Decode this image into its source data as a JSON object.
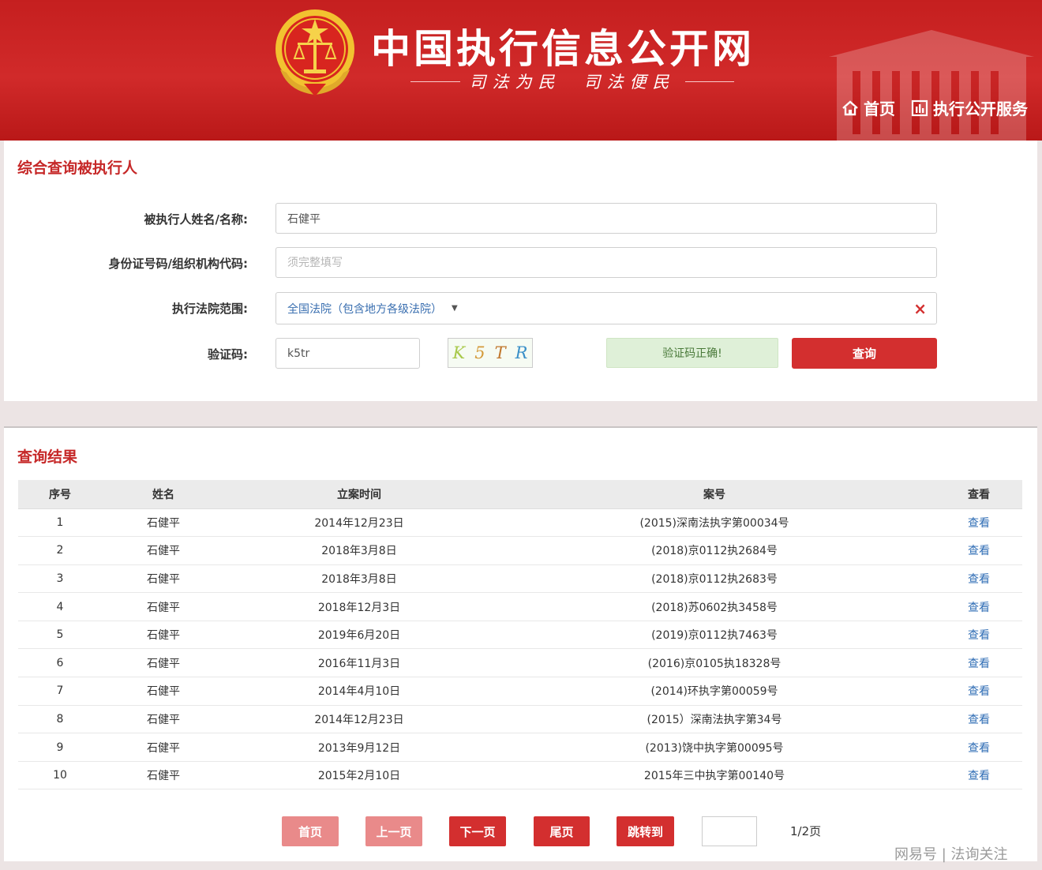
{
  "header": {
    "site_title": "中国执行信息公开网",
    "slogan": "司法为民　司法便民",
    "nav": [
      {
        "label": "首页",
        "icon": "home-icon"
      },
      {
        "label": "执行公开服务",
        "icon": "chart-icon"
      }
    ]
  },
  "query_panel": {
    "title": "综合查询被执行人",
    "fields": {
      "name_label": "被执行人姓名/名称:",
      "name_value": "石健平",
      "id_label": "身份证号码/组织机构代码:",
      "id_placeholder": "须完整填写",
      "court_label": "执行法院范围:",
      "court_value": "全国法院（包含地方各级法院）",
      "captcha_label": "验证码:",
      "captcha_value": "k5tr",
      "captcha_image_chars": [
        "K",
        "5",
        "T",
        "R"
      ]
    },
    "captcha_status": "验证码正确!",
    "query_button": "查询"
  },
  "results": {
    "title": "查询结果",
    "columns": [
      "序号",
      "姓名",
      "立案时间",
      "案号",
      "查看"
    ],
    "rows": [
      {
        "no": "1",
        "name": "石健平",
        "date": "2014年12月23日",
        "case": "(2015)深南法执字第00034号",
        "view": "查看"
      },
      {
        "no": "2",
        "name": "石健平",
        "date": "2018年3月8日",
        "case": "(2018)京0112执2684号",
        "view": "查看"
      },
      {
        "no": "3",
        "name": "石健平",
        "date": "2018年3月8日",
        "case": "(2018)京0112执2683号",
        "view": "查看"
      },
      {
        "no": "4",
        "name": "石健平",
        "date": "2018年12月3日",
        "case": "(2018)苏0602执3458号",
        "view": "查看"
      },
      {
        "no": "5",
        "name": "石健平",
        "date": "2019年6月20日",
        "case": "(2019)京0112执7463号",
        "view": "查看"
      },
      {
        "no": "6",
        "name": "石健平",
        "date": "2016年11月3日",
        "case": "(2016)京0105执18328号",
        "view": "查看"
      },
      {
        "no": "7",
        "name": "石健平",
        "date": "2014年4月10日",
        "case": "(2014)环执字第00059号",
        "view": "查看"
      },
      {
        "no": "8",
        "name": "石健平",
        "date": "2014年12月23日",
        "case": "(2015）深南法执字第34号",
        "view": "查看"
      },
      {
        "no": "9",
        "name": "石健平",
        "date": "2013年9月12日",
        "case": "(2013)饶中执字第00095号",
        "view": "查看"
      },
      {
        "no": "10",
        "name": "石健平",
        "date": "2015年2月10日",
        "case": "2015年三中执字第00140号",
        "view": "查看"
      }
    ],
    "pagination": {
      "first": "首页",
      "prev": "上一页",
      "next": "下一页",
      "last": "尾页",
      "jump": "跳转到",
      "page_info": "1/2页"
    }
  },
  "watermark": "网易号 | 法询关注",
  "colors": {
    "brand_red": "#d32f2f",
    "header_red": "#c51f1f",
    "link_blue": "#2f6db5",
    "success_green": "#dff0d8"
  }
}
